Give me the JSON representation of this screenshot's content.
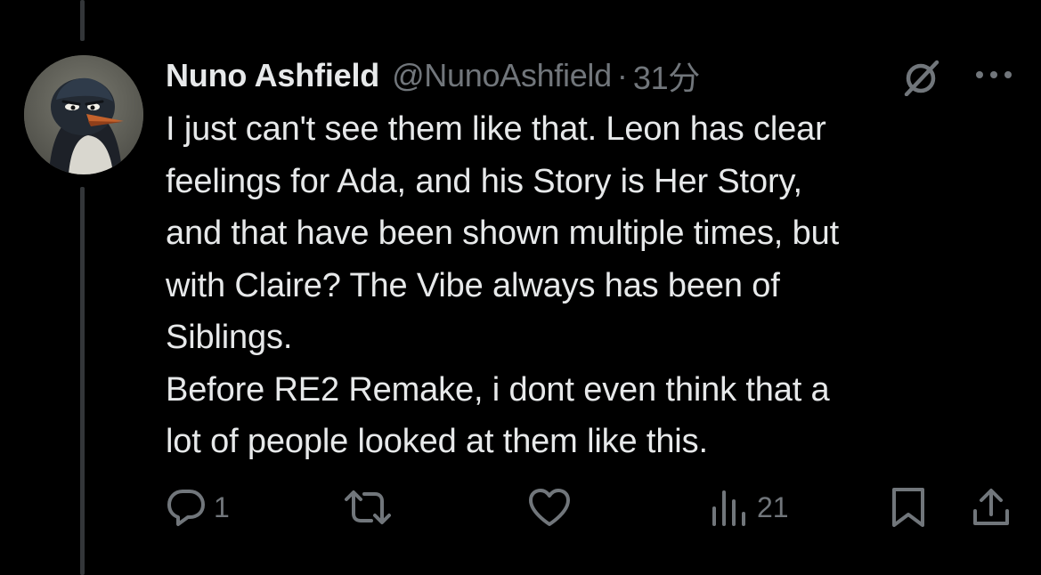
{
  "tweet": {
    "display_name": "Nuno Ashfield",
    "handle": "@NunoAshfield",
    "separator": "·",
    "timestamp": "31分",
    "avatar_icon": "penguin-avatar",
    "text_lines": [
      "I just can't see them like that. Leon has clear",
      "feelings for Ada, and his Story is Her Story,",
      "and that have been shown multiple times, but",
      "with Claire? The Vibe always has been of",
      "Siblings.",
      "Before RE2 Remake, i dont even think that a",
      "lot of people looked at them like this."
    ]
  },
  "actions": {
    "reply_count": "1",
    "repost_count": "",
    "like_count": "",
    "views_count": "21"
  },
  "icons": {
    "grok": "grok-icon",
    "more": "more-icon",
    "reply": "reply-icon",
    "repost": "repost-icon",
    "like": "heart-icon",
    "views": "views-icon",
    "bookmark": "bookmark-icon",
    "share": "share-icon"
  },
  "colors": {
    "background": "#000000",
    "text_primary": "#e7e9ea",
    "text_secondary": "#71767b",
    "thread_line": "#333639"
  }
}
